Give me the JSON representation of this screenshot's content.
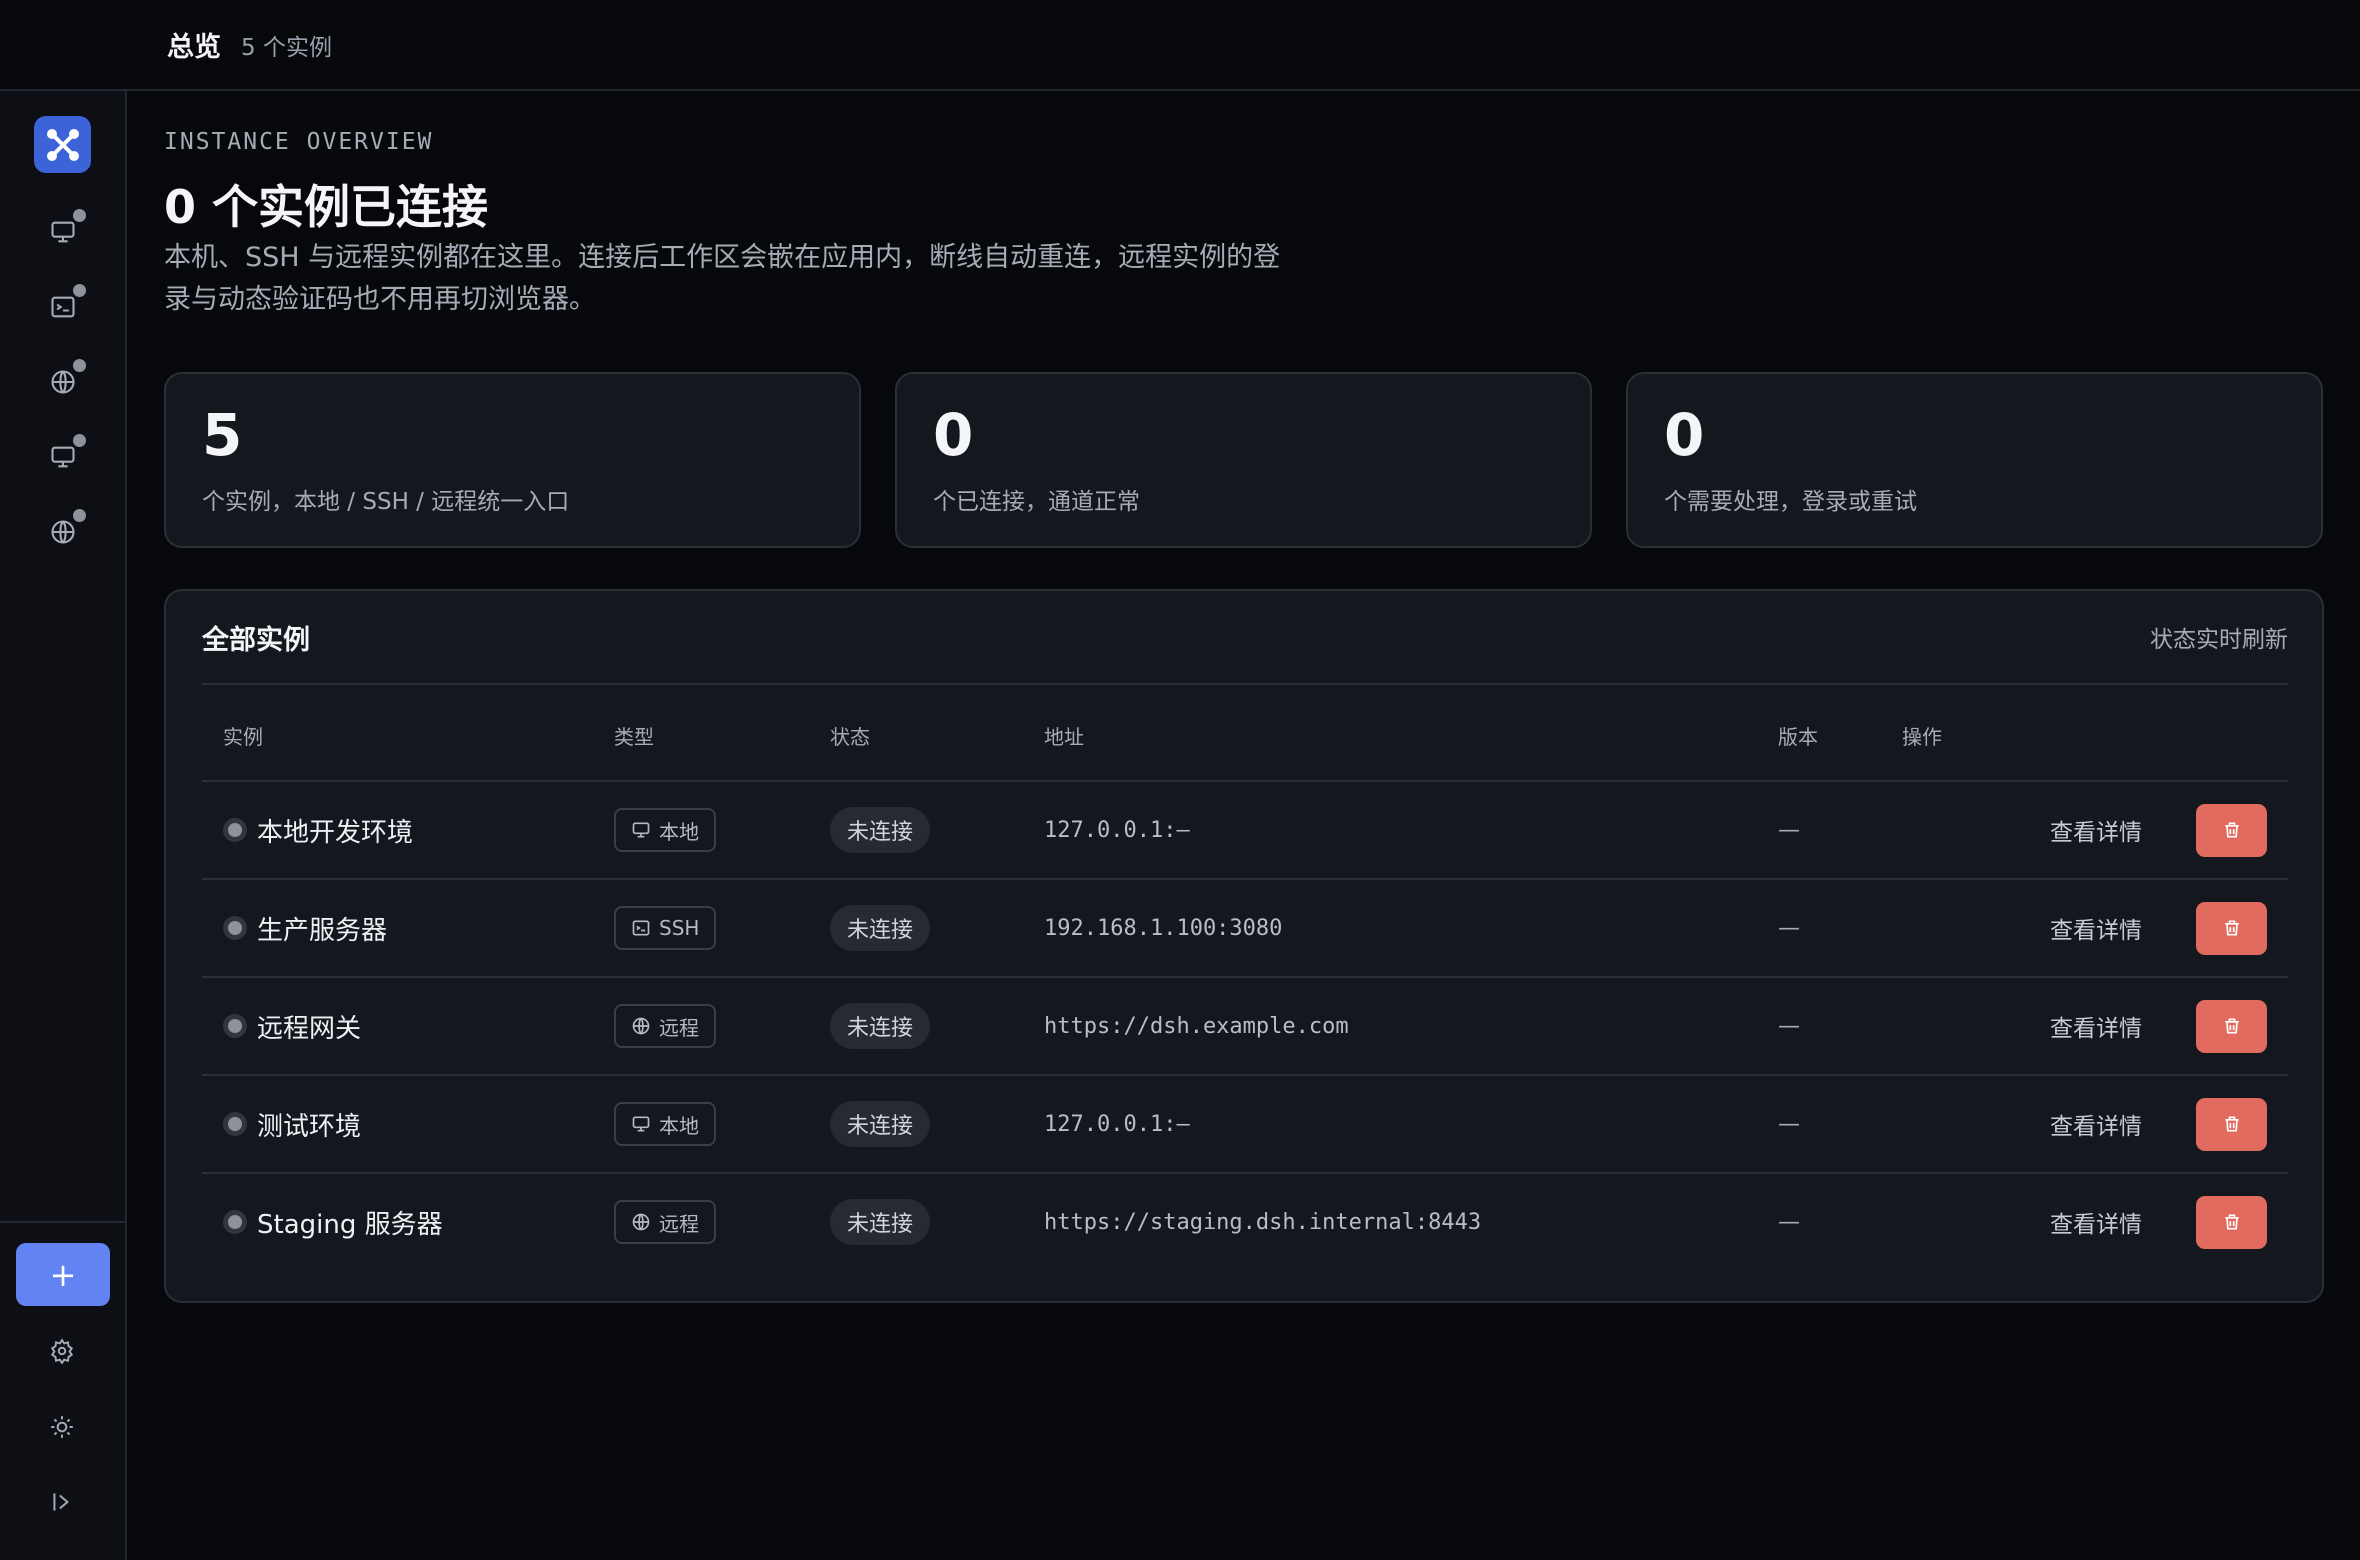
{
  "topbar": {
    "title": "总览",
    "count": "5 个实例"
  },
  "sidebar": {
    "logo": "app-logo",
    "nav": [
      {
        "icon": "monitor-icon",
        "status": "offline"
      },
      {
        "icon": "terminal-icon",
        "status": "offline"
      },
      {
        "icon": "globe-icon",
        "status": "offline"
      },
      {
        "icon": "monitor-icon",
        "status": "offline"
      },
      {
        "icon": "globe-icon",
        "status": "offline"
      }
    ],
    "add_label": "+",
    "tools": [
      "gear-icon",
      "sun-icon",
      "expand-sidebar-icon"
    ]
  },
  "header": {
    "eyebrow": "INSTANCE OVERVIEW",
    "headline": "0 个实例已连接",
    "description": "本机、SSH 与远程实例都在这里。连接后工作区会嵌在应用内，断线自动重连，远程实例的登录与动态验证码也不用再切浏览器。"
  },
  "stats": [
    {
      "value": "5",
      "label": "个实例，本地 / SSH / 远程统一入口"
    },
    {
      "value": "0",
      "label": "个已连接，通道正常"
    },
    {
      "value": "0",
      "label": "个需要处理，登录或重试"
    }
  ],
  "panel": {
    "title": "全部实例",
    "note": "状态实时刷新",
    "columns": [
      "实例",
      "类型",
      "状态",
      "地址",
      "版本",
      "操作"
    ],
    "detail_label": "查看详情",
    "rows": [
      {
        "name": "本地开发环境",
        "type": "本地",
        "type_icon": "monitor-icon",
        "state": "未连接",
        "address": "127.0.0.1:—",
        "version": "—"
      },
      {
        "name": "生产服务器",
        "type": "SSH",
        "type_icon": "terminal-icon",
        "state": "未连接",
        "address": "192.168.1.100:3080",
        "version": "—"
      },
      {
        "name": "远程网关",
        "type": "远程",
        "type_icon": "globe-icon",
        "state": "未连接",
        "address": "https://dsh.example.com",
        "version": "—"
      },
      {
        "name": "测试环境",
        "type": "本地",
        "type_icon": "monitor-icon",
        "state": "未连接",
        "address": "127.0.0.1:—",
        "version": "—"
      },
      {
        "name": "Staging 服务器",
        "type": "远程",
        "type_icon": "globe-icon",
        "state": "未连接",
        "address": "https://staging.dsh.internal:8443",
        "version": "—"
      }
    ]
  },
  "colors": {
    "accent": "#6383f2",
    "danger": "#e06b5e",
    "logo": "#3d63d8"
  }
}
